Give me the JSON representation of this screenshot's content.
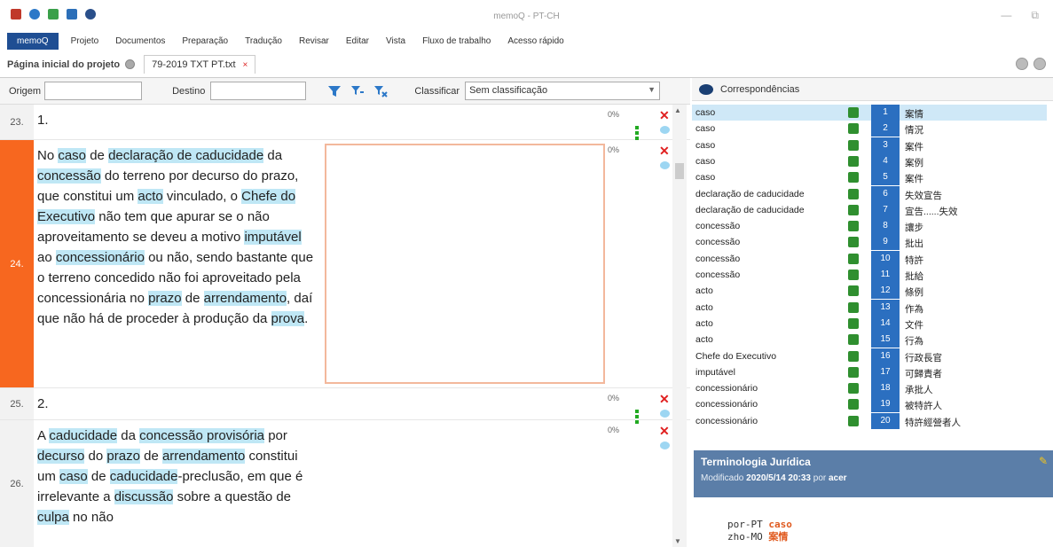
{
  "window": {
    "title": "memoQ - PT-CH",
    "minimize_label": "—",
    "restore_label": "⧉"
  },
  "toolbar_icons": [
    "search-icon",
    "globe-icon",
    "network-icon",
    "grid-icon",
    "settings-icon"
  ],
  "menu": {
    "main": "memoQ",
    "items": [
      "Projeto",
      "Documentos",
      "Preparação",
      "Tradução",
      "Revisar",
      "Editar",
      "Vista",
      "Fluxo de trabalho",
      "Acesso rápido"
    ]
  },
  "tabs": {
    "home": "Página inicial do projeto",
    "document": "79-2019 TXT PT.txt",
    "close": "×"
  },
  "filter": {
    "source_label": "Origem",
    "target_label": "Destino",
    "sort_label": "Classificar",
    "sort_value": "Sem classificação"
  },
  "rows": [
    {
      "num": "23.",
      "pct": "0%",
      "segments": [
        {
          "t": "1.",
          "h": false
        }
      ]
    },
    {
      "num": "24.",
      "pct": "0%",
      "segments": [
        {
          "t": "No ",
          "h": false
        },
        {
          "t": "caso",
          "h": true
        },
        {
          "t": " de ",
          "h": false
        },
        {
          "t": "declaração de caducidade",
          "h": true
        },
        {
          "t": " da ",
          "h": false
        },
        {
          "t": "concessão",
          "h": true
        },
        {
          "t": " do terreno por decurso do prazo, que constitui um ",
          "h": false
        },
        {
          "t": "acto",
          "h": true
        },
        {
          "t": " vinculado, o ",
          "h": false
        },
        {
          "t": "Chefe do Executivo",
          "h": true
        },
        {
          "t": " não tem que apurar se o não aproveitamento se deveu a motivo ",
          "h": false
        },
        {
          "t": "imputável",
          "h": true
        },
        {
          "t": " ao ",
          "h": false
        },
        {
          "t": "concessionário",
          "h": true
        },
        {
          "t": " ou não, sendo bastante que o terreno concedido não foi aproveitado pela concessionária no ",
          "h": false
        },
        {
          "t": "prazo",
          "h": true
        },
        {
          "t": " de ",
          "h": false
        },
        {
          "t": "arrendamento",
          "h": true
        },
        {
          "t": ", daí que não há de proceder à produção da ",
          "h": false
        },
        {
          "t": "prova",
          "h": true
        },
        {
          "t": ".",
          "h": false
        }
      ]
    },
    {
      "num": "25.",
      "pct": "0%",
      "segments": [
        {
          "t": "2.",
          "h": false
        }
      ]
    },
    {
      "num": "26.",
      "pct": "0%",
      "segments": [
        {
          "t": "A ",
          "h": false
        },
        {
          "t": "caducidade",
          "h": true
        },
        {
          "t": " da ",
          "h": false
        },
        {
          "t": "concessão provisória",
          "h": true
        },
        {
          "t": " por ",
          "h": false
        },
        {
          "t": "decurso",
          "h": true
        },
        {
          "t": " do ",
          "h": false
        },
        {
          "t": "prazo",
          "h": true
        },
        {
          "t": " de ",
          "h": false
        },
        {
          "t": "arrendamento",
          "h": true
        },
        {
          "t": " constitui um ",
          "h": false
        },
        {
          "t": "caso",
          "h": true
        },
        {
          "t": " de ",
          "h": false
        },
        {
          "t": "caducidade",
          "h": true
        },
        {
          "t": "-preclusão, em que é irrelevante a ",
          "h": false
        },
        {
          "t": "discussão",
          "h": true
        },
        {
          "t": " sobre a questão de ",
          "h": false
        },
        {
          "t": "culpa",
          "h": true
        },
        {
          "t": " no não",
          "h": false
        }
      ]
    }
  ],
  "matches": {
    "title": "Correspondências",
    "items": [
      {
        "src": "caso",
        "idx": "1",
        "tgt": "案情",
        "selected": true
      },
      {
        "src": "caso",
        "idx": "2",
        "tgt": "情況",
        "selected": false
      },
      {
        "src": "caso",
        "idx": "3",
        "tgt": "案件",
        "selected": false
      },
      {
        "src": "caso",
        "idx": "4",
        "tgt": "案例",
        "selected": false
      },
      {
        "src": "caso",
        "idx": "5",
        "tgt": "案件",
        "selected": false
      },
      {
        "src": "declaração de caducidade",
        "idx": "6",
        "tgt": "失效宣告",
        "selected": false
      },
      {
        "src": "declaração de caducidade",
        "idx": "7",
        "tgt": "宣告......失效",
        "selected": false
      },
      {
        "src": "concessão",
        "idx": "8",
        "tgt": "讓步",
        "selected": false
      },
      {
        "src": "concessão",
        "idx": "9",
        "tgt": "批出",
        "selected": false
      },
      {
        "src": "concessão",
        "idx": "10",
        "tgt": "特許",
        "selected": false
      },
      {
        "src": "concessão",
        "idx": "11",
        "tgt": "批給",
        "selected": false
      },
      {
        "src": "acto",
        "idx": "12",
        "tgt": "條例",
        "selected": false
      },
      {
        "src": "acto",
        "idx": "13",
        "tgt": "作為",
        "selected": false
      },
      {
        "src": "acto",
        "idx": "14",
        "tgt": "文件",
        "selected": false
      },
      {
        "src": "acto",
        "idx": "15",
        "tgt": "行為",
        "selected": false
      },
      {
        "src": "Chefe do Executivo",
        "idx": "16",
        "tgt": "行政長官",
        "selected": false
      },
      {
        "src": "imputável",
        "idx": "17",
        "tgt": "可歸責者",
        "selected": false
      },
      {
        "src": "concessionário",
        "idx": "18",
        "tgt": "承批人",
        "selected": false
      },
      {
        "src": "concessionário",
        "idx": "19",
        "tgt": "被特許人",
        "selected": false
      },
      {
        "src": "concessionário",
        "idx": "20",
        "tgt": "特許經營者人",
        "selected": false
      }
    ]
  },
  "terminology": {
    "title": "Terminologia Jurídica",
    "modified_prefix": "Modificado",
    "modified_date": "2020/5/14 20:33",
    "by_label": "por",
    "author": "acer",
    "lang1": "por-PT",
    "val1": "caso",
    "lang2": "zho-MO",
    "val2": "案情"
  },
  "colors": {
    "active_row": "#f7671f",
    "highlight": "#bfe7f5",
    "memoq_blue": "#1f4e93",
    "term_header": "#5b7ea8"
  }
}
